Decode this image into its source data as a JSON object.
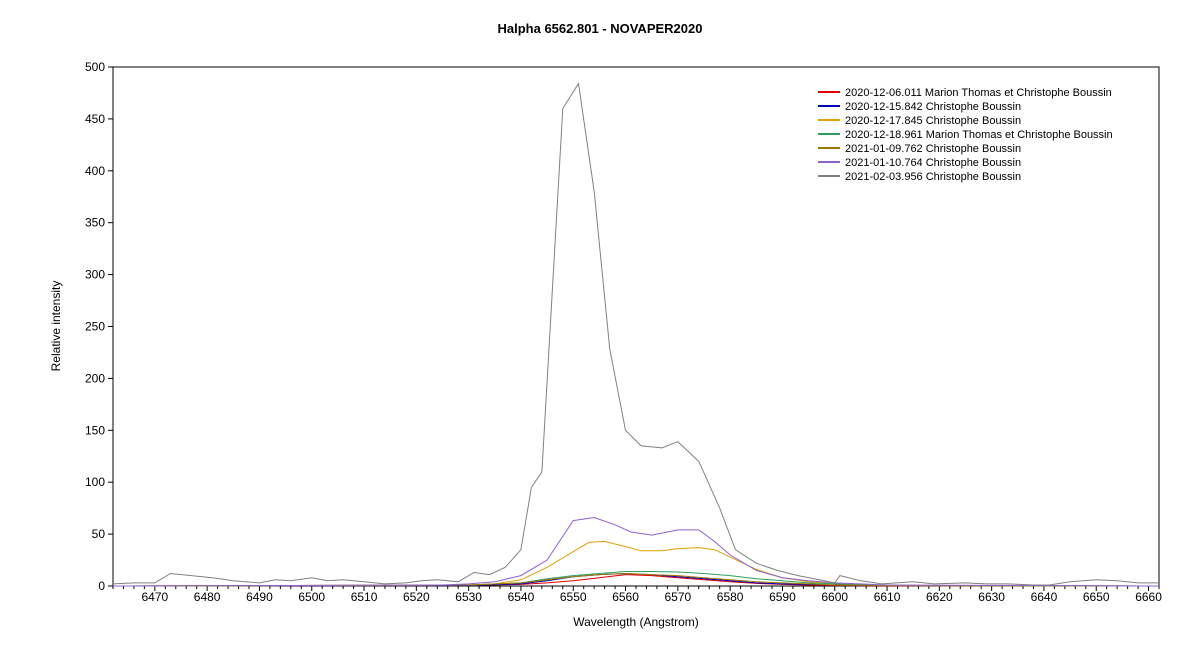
{
  "chart_data": {
    "type": "line",
    "title": "Halpha 6562.801 - NOVAPER2020",
    "xlabel": "Wavelength (Angstrom)",
    "ylabel": "Relative intensity",
    "xlim": [
      6462,
      6662
    ],
    "ylim": [
      0,
      500
    ],
    "xticks": [
      6470,
      6480,
      6490,
      6500,
      6510,
      6520,
      6530,
      6540,
      6550,
      6560,
      6570,
      6580,
      6590,
      6600,
      6610,
      6620,
      6630,
      6640,
      6650,
      6660
    ],
    "yticks": [
      0,
      50,
      100,
      150,
      200,
      250,
      300,
      350,
      400,
      450,
      500
    ],
    "grid": false,
    "legend_position": "top-right",
    "series": [
      {
        "name": "2020-12-06.011  Marion Thomas et Christophe Boussin",
        "color": "#e00000",
        "x": [
          6462,
          6530,
          6540,
          6545,
          6550,
          6555,
          6560,
          6565,
          6570,
          6575,
          6580,
          6585,
          6590,
          6595,
          6600,
          6610,
          6662
        ],
        "y": [
          0,
          0.5,
          1.5,
          3,
          5,
          8,
          11,
          10,
          8,
          6,
          4,
          2.5,
          1.5,
          1,
          0.5,
          0.2,
          0
        ]
      },
      {
        "name": "2020-12-15.842  Christophe Boussin",
        "color": "#0000c0",
        "x": [
          6462,
          6530,
          6540,
          6545,
          6550,
          6555,
          6560,
          6565,
          6570,
          6575,
          6580,
          6585,
          6590,
          6595,
          6600,
          6610,
          6662
        ],
        "y": [
          0,
          0.5,
          2,
          5,
          9,
          11,
          12,
          11,
          9,
          7,
          5,
          3,
          2,
          1.5,
          1,
          0.5,
          0
        ]
      },
      {
        "name": "2020-12-17.845  Christophe Boussin",
        "color": "#e0a000",
        "x": [
          6462,
          6530,
          6535,
          6540,
          6545,
          6550,
          6553,
          6556,
          6560,
          6563,
          6567,
          6570,
          6574,
          6577,
          6580,
          6585,
          6590,
          6595,
          6600,
          6610,
          6662
        ],
        "y": [
          0,
          1,
          2,
          6,
          18,
          33,
          42,
          43,
          38,
          34,
          34,
          36,
          37,
          35,
          28,
          16,
          8,
          4,
          2,
          0.5,
          0
        ]
      },
      {
        "name": "2020-12-18.961  Marion Thomas et Christophe Boussin",
        "color": "#2ca060",
        "x": [
          6462,
          6530,
          6540,
          6545,
          6550,
          6555,
          6560,
          6565,
          6570,
          6575,
          6580,
          6585,
          6590,
          6595,
          6600,
          6610,
          6662
        ],
        "y": [
          0,
          1,
          3,
          7,
          10,
          12,
          14,
          14,
          13.5,
          12,
          10,
          7,
          5,
          3,
          2,
          0.5,
          0
        ]
      },
      {
        "name": "2021-01-09.762  Christophe Boussin",
        "color": "#a07800",
        "x": [
          6462,
          6530,
          6540,
          6545,
          6550,
          6555,
          6560,
          6565,
          6570,
          6575,
          6580,
          6585,
          6590,
          6595,
          6600,
          6610,
          6662
        ],
        "y": [
          0,
          1,
          3,
          6,
          9,
          11,
          12,
          11,
          10,
          8,
          6,
          4,
          3,
          2,
          1,
          0.5,
          0
        ]
      },
      {
        "name": "2021-01-10.764  Christophe Boussin",
        "color": "#9060d0",
        "x": [
          6462,
          6525,
          6530,
          6535,
          6540,
          6545,
          6550,
          6554,
          6558,
          6561,
          6565,
          6570,
          6574,
          6577,
          6580,
          6585,
          6590,
          6595,
          6600,
          6610,
          6662
        ],
        "y": [
          0,
          1,
          2,
          4,
          10,
          25,
          63,
          66,
          59,
          52,
          49,
          54,
          54,
          43,
          30,
          15,
          8,
          5,
          3,
          1,
          0
        ]
      },
      {
        "name": "2021-02-03.956  Christophe Boussin",
        "color": "#808080",
        "x": [
          6462,
          6466,
          6470,
          6473,
          6477,
          6481,
          6485,
          6490,
          6493,
          6496,
          6500,
          6503,
          6506,
          6510,
          6514,
          6518,
          6521,
          6524,
          6528,
          6531,
          6534,
          6537,
          6540,
          6542,
          6544,
          6548,
          6551,
          6554,
          6557,
          6560,
          6563,
          6567,
          6570,
          6574,
          6578,
          6581,
          6585,
          6589,
          6593,
          6597,
          6600,
          6601,
          6605,
          6609,
          6615,
          6619,
          6625,
          6629,
          6633,
          6638,
          6641,
          6645,
          6650,
          6654,
          6658,
          6662
        ],
        "y": [
          2,
          3,
          3,
          12,
          10,
          8,
          5,
          3,
          6,
          5,
          8,
          5,
          6,
          4,
          2,
          3,
          5,
          6,
          4,
          13,
          11,
          18,
          35,
          95,
          110,
          460,
          484,
          380,
          228,
          150,
          135,
          133,
          139,
          120,
          75,
          35,
          22,
          15,
          10,
          6,
          3,
          10,
          5,
          2,
          4,
          2,
          3,
          2,
          2,
          1,
          1,
          4,
          6,
          5,
          3,
          3
        ]
      }
    ]
  }
}
